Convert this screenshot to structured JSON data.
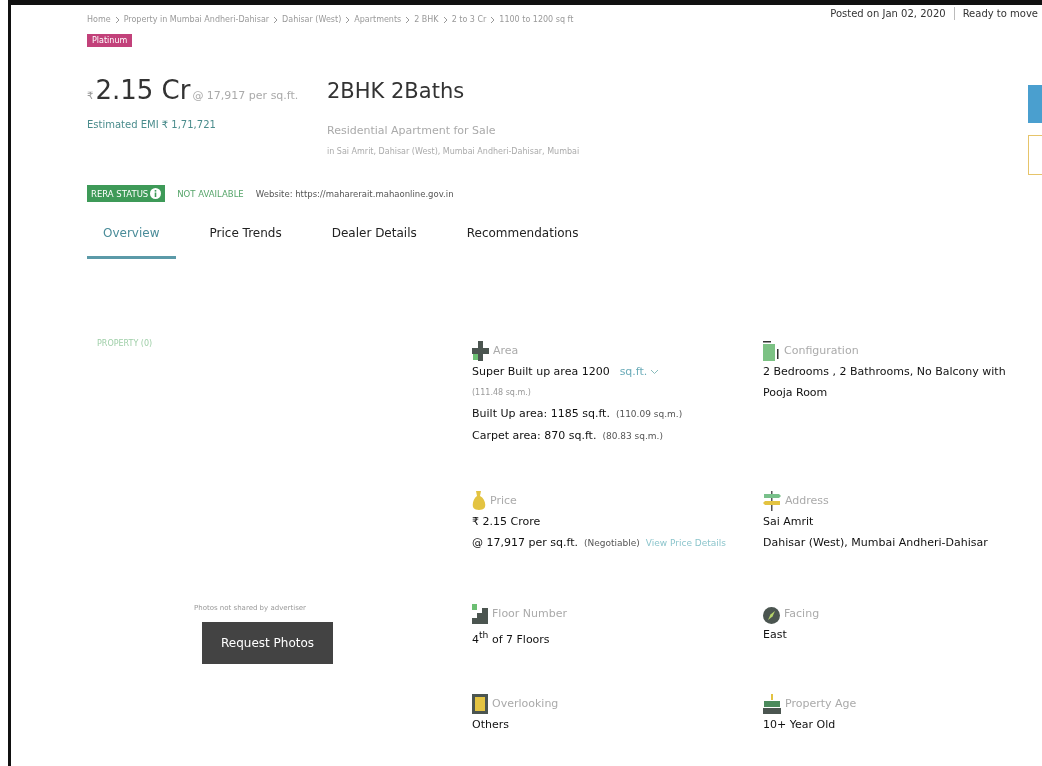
{
  "breadcrumb": [
    "Home",
    "Property in Mumbai Andheri-Dahisar",
    "Dahisar (West)",
    "Apartments",
    "2 BHK",
    "2 to 3 Cr",
    "1100 to 1200 sq ft"
  ],
  "posted": "Posted on Jan 02, 2020",
  "availability": "Ready to move",
  "badge": "Platinum",
  "price": {
    "currency": "₹",
    "amount": "2.15 Cr",
    "rate": "@ 17,917 per sq.ft.",
    "emi_label": "Estimated EMI",
    "emi": "₹ 1,71,721"
  },
  "title": "2BHK 2Baths",
  "subtitle": "Residential Apartment for Sale",
  "location": "in Sai Amrit, Dahisar (West),  Mumbai Andheri-Dahisar, Mumbai",
  "rera": {
    "label": "RERA STATUS",
    "status": "NOT AVAILABLE",
    "website": "Website: https://maharerait.mahaonline.gov.in"
  },
  "tabs": [
    {
      "label": "Overview",
      "selected": true
    },
    {
      "label": "Price Trends",
      "selected": false
    },
    {
      "label": "Dealer Details",
      "selected": false
    },
    {
      "label": "Recommendations",
      "selected": false
    }
  ],
  "photos": {
    "heading": "PROPERTY (0)",
    "note": "Photos not shared by advertiser",
    "button": "Request Photos"
  },
  "features": [
    {
      "label": "Area",
      "lines": [
        {
          "main": "Super Built up area 1200",
          "unit": "sq.ft."
        },
        {
          "note": "(111.48 sq.m.)"
        },
        {
          "main": "Built Up area: 1185 sq.ft.",
          "note": "(110.09 sq.m.)"
        },
        {
          "main": "Carpet area: 870 sq.ft.",
          "note": "(80.83 sq.m.)"
        }
      ]
    },
    {
      "label": "Configuration",
      "lines": [
        {
          "main": "2 Bedrooms , 2 Bathrooms, No Balcony with Pooja Room"
        }
      ]
    },
    {
      "label": "Price",
      "lines": [
        {
          "main": "₹ 2.15 Crore"
        },
        {
          "main": "@ 17,917 per sq.ft.",
          "note": "(Negotiable)",
          "link": "View Price Details"
        }
      ]
    },
    {
      "label": "Address",
      "lines": [
        {
          "main": "Sai Amrit"
        },
        {
          "main": "Dahisar (West), Mumbai Andheri-Dahisar"
        }
      ]
    },
    {
      "label": "Floor Number",
      "lines": [
        {
          "main": "4$^{th}$  of 7 Floors"
        }
      ]
    },
    {
      "label": "Facing",
      "lines": [
        {
          "main": "East"
        }
      ]
    },
    {
      "label": "Overlooking",
      "lines": [
        {
          "main": "Others"
        }
      ]
    },
    {
      "label": "Property Age",
      "lines": [
        {
          "main": "10+ Year Old"
        }
      ]
    }
  ]
}
